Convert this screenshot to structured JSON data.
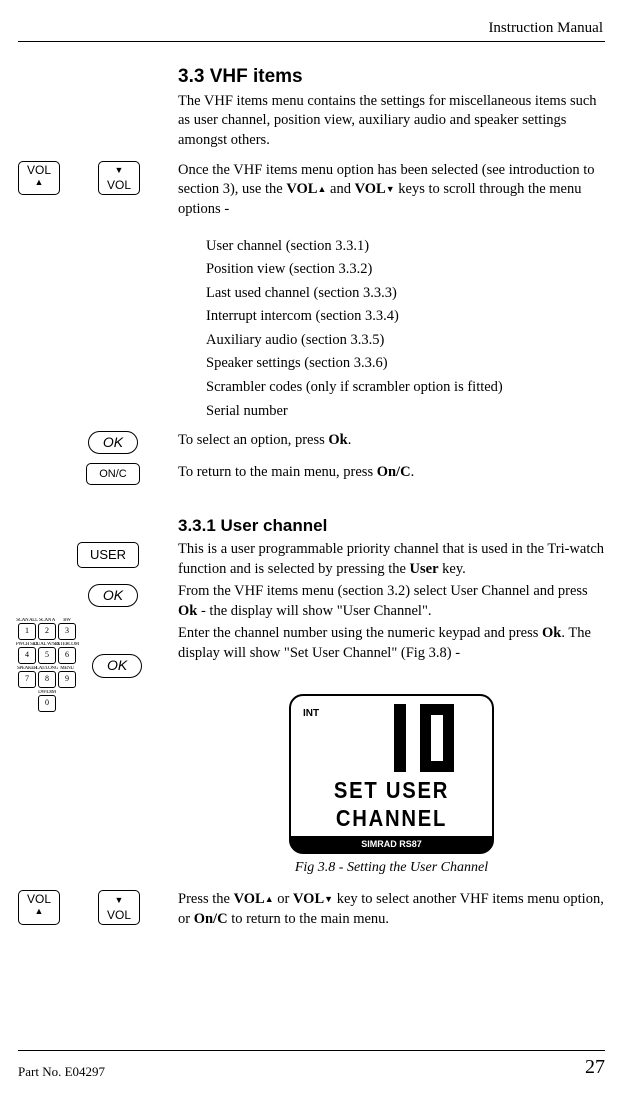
{
  "header": {
    "title": "Instruction Manual"
  },
  "section_3_3": {
    "heading": "3.3  VHF items",
    "intro": "The VHF items menu contains the settings for miscellaneous items such as user channel, position view, auxiliary audio and speaker settings amongst others.",
    "scroll_p1": "Once the VHF items menu option has been selected (see intro­duction to section 3), use the ",
    "scroll_p2": " and ",
    "scroll_p3": " keys to scroll through the menu options -",
    "vol_label": "VOL",
    "list": [
      "User channel (section  3.3.1)",
      "Position view (section  3.3.2)",
      "Last used channel (section  3.3.3)",
      "Interrupt intercom (section  3.3.4)",
      "Auxiliary audio (section  3.3.5)",
      "Speaker settings (section  3.3.6)",
      "Scrambler codes (only if scrambler option is fitted)",
      "Serial number"
    ],
    "select_p1": "To select an option, press ",
    "select_key": "Ok",
    "select_p2": ".",
    "return_p1": "To return to the main menu, press ",
    "return_key": "On/C",
    "return_p2": "."
  },
  "section_3_3_1": {
    "heading": "3.3.1     User channel",
    "p1a": "This is a user programmable priority channel that is used in the Tri-watch function and is selected by pressing the ",
    "p1key": "User",
    "p1b": " key.",
    "p2a": "From the VHF items menu (section 3.2) select User Channel and press ",
    "p2key": "Ok",
    "p2b": " - the display will show \"User Channel\".",
    "p3a": "Enter the channel number using the numeric keypad and press ",
    "p3key": "Ok",
    "p3b": ".  The display will show \"Set User Channel\" (Fig 3.8) -",
    "display": {
      "int": "INT",
      "line1": "SET USER",
      "line2": "CHANNEL",
      "brand": "SIMRAD RS87"
    },
    "fig_caption": "Fig 3.8 - Setting the User Channel",
    "p4a": "Press the ",
    "p4b": " or ",
    "p4c": " key to select another VHF items menu option, or ",
    "p4key": "On/C",
    "p4d": " to return to the main menu."
  },
  "buttons": {
    "vol_up": "VOL",
    "vol_down": "VOL",
    "ok": "OK",
    "onc": "ON/C",
    "user": "USER"
  },
  "keypad": {
    "row_labels_top": [
      "SCAN ALL",
      "SCAN A",
      "BW"
    ],
    "row1": [
      "1",
      "2",
      "3"
    ],
    "row_labels_2": [
      "PWCH SET",
      "DUAL W/SEL",
      "INTERCOM"
    ],
    "row2": [
      "4",
      "5",
      "6"
    ],
    "row_labels_3": [
      "SPEAKER",
      "LAT/LONG",
      "MENU"
    ],
    "row3": [
      "7",
      "8",
      "9"
    ],
    "row_labels_4": [
      "",
      "DW/DIM",
      ""
    ],
    "row4": [
      "",
      "0",
      ""
    ]
  },
  "footer": {
    "part": "Part No. E04297",
    "page": "27"
  }
}
